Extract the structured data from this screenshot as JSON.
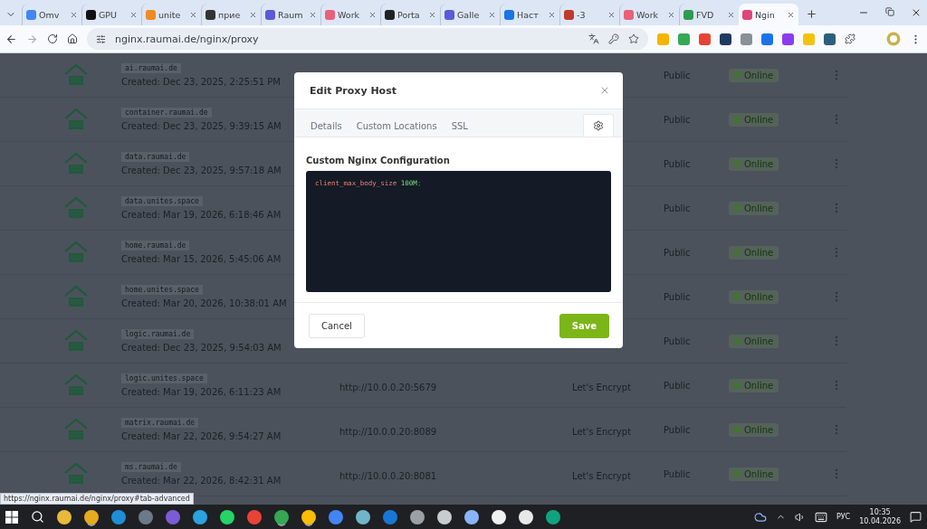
{
  "browser": {
    "tabs": [
      {
        "title": "Omv",
        "color": "#4285f4",
        "selected": false
      },
      {
        "title": "GPU",
        "color": "#111111",
        "selected": false
      },
      {
        "title": "unite",
        "color": "#f08a24",
        "selected": false
      },
      {
        "title": "прие",
        "color": "#333333",
        "selected": false
      },
      {
        "title": "Raum",
        "color": "#5b5bd6",
        "selected": false
      },
      {
        "title": "Work",
        "color": "#e8607a",
        "selected": false
      },
      {
        "title": "Porta",
        "color": "#222222",
        "selected": false
      },
      {
        "title": "Galle",
        "color": "#5b5bd6",
        "selected": false
      },
      {
        "title": "Наст",
        "color": "#1a73e8",
        "selected": false
      },
      {
        "title": "-3",
        "color": "#c0392b",
        "selected": false
      },
      {
        "title": "Work",
        "color": "#e8607a",
        "selected": false
      },
      {
        "title": "FVD",
        "color": "#2e9b4f",
        "selected": false
      },
      {
        "title": "Ngin",
        "color": "#e0457b",
        "selected": true
      }
    ],
    "url": "nginx.raumai.de/nginx/proxy",
    "extensions": [
      {
        "color": "#f6b400"
      },
      {
        "color": "#34a853"
      },
      {
        "color": "#e94235"
      },
      {
        "color": "#1f3a5f"
      },
      {
        "color": "#8a8f98"
      },
      {
        "color": "#1a73e8"
      },
      {
        "color": "#8b3cf0"
      },
      {
        "color": "#f4c20d"
      },
      {
        "color": "#2b5f7a"
      }
    ]
  },
  "hosts": [
    {
      "name": "ai.raumai.de",
      "created": "Created: Dec 23, 2025, 2:25:51 PM",
      "access": "Public",
      "status": "Online"
    },
    {
      "name": "container.raumai.de",
      "created": "Created: Dec 23, 2025, 9:39:15 AM",
      "access": "Public",
      "status": "Online"
    },
    {
      "name": "data.raumai.de",
      "created": "Created: Dec 23, 2025, 9:57:18 AM",
      "access": "Public",
      "status": "Online"
    },
    {
      "name": "data.unites.space",
      "created": "Created: Mar 19, 2026, 6:18:46 AM",
      "access": "Public",
      "status": "Online"
    },
    {
      "name": "home.raumai.de",
      "created": "Created: Mar 15, 2026, 5:45:06 AM",
      "access": "Public",
      "status": "Online"
    },
    {
      "name": "home.unites.space",
      "created": "Created: Mar 20, 2026, 10:38:01 AM",
      "access": "Public",
      "status": "Online"
    },
    {
      "name": "logic.raumai.de",
      "created": "Created: Dec 23, 2025, 9:54:03 AM",
      "access": "Public",
      "status": "Online"
    },
    {
      "name": "logic.unites.space",
      "created": "Created: Mar 19, 2026, 6:11:23 AM",
      "destination": "http://10.0.0.20:5679",
      "ssl": "Let's Encrypt",
      "access": "Public",
      "status": "Online"
    },
    {
      "name": "matrix.raumai.de",
      "created": "Created: Mar 22, 2026, 9:54:27 AM",
      "destination": "http://10.0.0.20:8089",
      "ssl": "Let's Encrypt",
      "access": "Public",
      "status": "Online"
    },
    {
      "name": "ms.raumai.de",
      "created": "Created: Mar 22, 2026, 8:42:31 AM",
      "destination": "http://10.0.0.20:8081",
      "ssl": "Let's Encrypt",
      "access": "Public",
      "status": "Online"
    }
  ],
  "modal": {
    "title": "Edit Proxy Host",
    "tabs": [
      {
        "kind": "text",
        "label": "Details",
        "selected": false
      },
      {
        "kind": "text",
        "label": "Custom Locations",
        "selected": false
      },
      {
        "kind": "text",
        "label": "SSL",
        "selected": false
      },
      {
        "kind": "gear",
        "selected": true
      }
    ],
    "field_label": "Custom Nginx Configuration",
    "code": [
      {
        "kind": "directive",
        "text": "client_max_body_size"
      },
      {
        "kind": "value",
        "text": "100M"
      },
      {
        "kind": "punct",
        "text": ";"
      }
    ],
    "buttons": [
      {
        "kind": "secondary",
        "label": "Cancel"
      },
      {
        "kind": "primary",
        "label": "Save"
      }
    ]
  },
  "status_link": "https://nginx.raumai.de/nginx/proxy#tab-advanced",
  "taskbar": {
    "apps": [
      {
        "color": "#e8b93b",
        "open": false
      },
      {
        "color": "#e6a91f",
        "open": true
      },
      {
        "color": "#1e8fd6",
        "open": false
      },
      {
        "color": "#6b7a8a",
        "open": false
      },
      {
        "color": "#7b5cd6",
        "open": false
      },
      {
        "color": "#2aa3e0",
        "open": false
      },
      {
        "color": "#25d366",
        "open": false
      },
      {
        "color": "#ea4335",
        "open": false
      },
      {
        "color": "#34a853",
        "open": true
      },
      {
        "color": "#fbbc05",
        "open": true
      },
      {
        "color": "#4285f4",
        "open": false
      },
      {
        "color": "#6fb6c9",
        "open": false
      },
      {
        "color": "#1877d6",
        "open": false
      },
      {
        "color": "#9aa0a6",
        "open": false
      },
      {
        "color": "#c8ccd0",
        "open": false
      },
      {
        "color": "#8ab4f8",
        "open": false
      },
      {
        "color": "#f1f1f1",
        "open": false
      },
      {
        "color": "#e8e8e8",
        "open": false
      },
      {
        "color": "#10a37f",
        "open": false
      }
    ],
    "language": "РУС",
    "time": "10:35",
    "date": "10.04.2026"
  }
}
